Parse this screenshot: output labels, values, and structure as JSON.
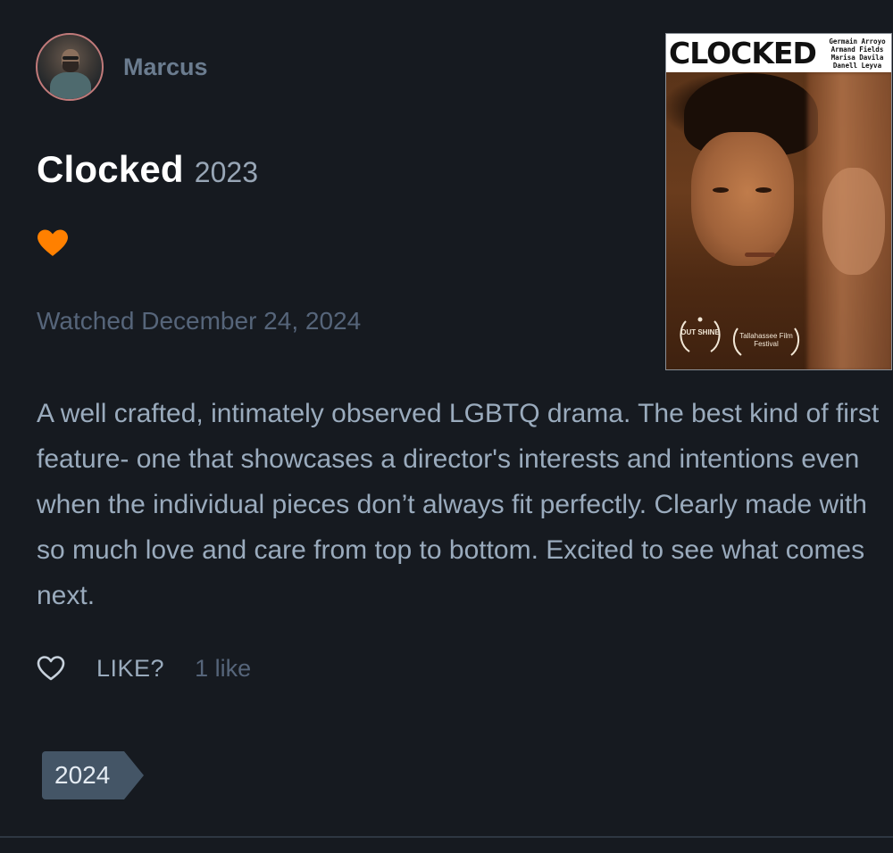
{
  "user": {
    "name": "Marcus"
  },
  "film": {
    "title": "Clocked",
    "year": "2023"
  },
  "rating": {
    "liked": true,
    "heart_color": "#ff8000"
  },
  "watched": {
    "text": "Watched December 24, 2024"
  },
  "poster": {
    "title": "CLOCKED",
    "credits": [
      "Germain Arroyo",
      "Armand Fields",
      "Marisa Davila",
      "Danell Leyva"
    ],
    "laurels": [
      {
        "label": "OUT SHINE"
      },
      {
        "label": "Tallahassee Film Festival"
      }
    ]
  },
  "review": {
    "text": "A well crafted, intimately observed LGBTQ drama. The best kind of first feature- one that showcases a director's interests and intentions even when the individual pieces don’t always fit perfectly. Clearly made with so much love and care from top to bottom. Excited to see what comes next."
  },
  "like_bar": {
    "label": "LIKE?",
    "count": "1 like"
  },
  "tags": [
    {
      "label": "2024"
    }
  ],
  "colors": {
    "background": "#161a20",
    "title": "#ffffff",
    "body_text": "#9aabbd",
    "muted_text": "#56657a",
    "tag_background": "#445566",
    "accent_orange": "#ff8000"
  }
}
